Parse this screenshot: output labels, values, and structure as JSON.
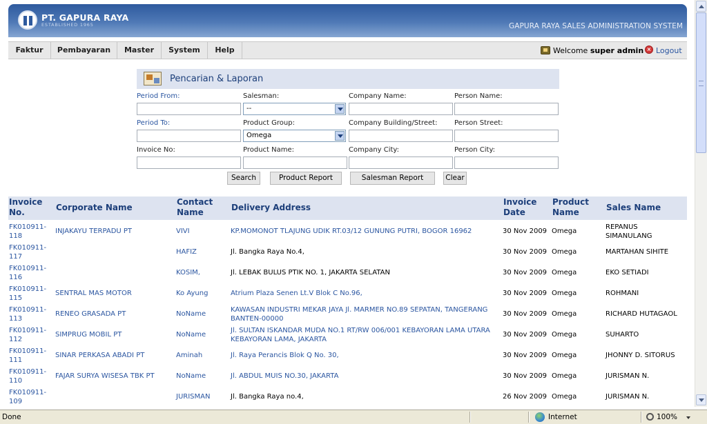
{
  "header": {
    "company_name": "PT. GAPURA RAYA",
    "established": "ESTABLISHED 1965",
    "system_title": "GAPURA RAYA SALES ADMINISTRATION SYSTEM"
  },
  "menu": [
    {
      "label": "Faktur"
    },
    {
      "label": "Pembayaran"
    },
    {
      "label": "Master"
    },
    {
      "label": "System"
    },
    {
      "label": "Help"
    }
  ],
  "user": {
    "welcome": "Welcome",
    "name": "super admin",
    "logout": "Logout"
  },
  "search": {
    "title": "Pencarian & Laporan",
    "period_from_label": "Period From:",
    "salesman_label": "Salesman:",
    "salesman_value": "--",
    "company_name_label": "Company Name:",
    "person_name_label": "Person Name:",
    "period_to_label": "Period To:",
    "product_group_label": "Product Group:",
    "product_group_value": "Omega",
    "company_street_label": "Company Building/Street:",
    "person_street_label": "Person Street:",
    "invoice_no_label": "Invoice No:",
    "product_name_label": "Product Name:",
    "company_city_label": "Company City:",
    "person_city_label": "Person City:",
    "buttons": {
      "search": "Search",
      "product_report": "Product Report",
      "salesman_report": "Salesman Report",
      "clear": "Clear"
    }
  },
  "table": {
    "headers": {
      "invoice": [
        "Invoice",
        "No."
      ],
      "corporate": "Corporate Name",
      "contact": [
        "Contact",
        "Name"
      ],
      "address": "Delivery Address",
      "date": [
        "Invoice",
        "Date"
      ],
      "product": [
        "Product",
        "Name"
      ],
      "sales": "Sales Name"
    },
    "rows": [
      {
        "inv1": "FK010911-",
        "inv2": "118",
        "corp": "INJAKAYU TERPADU PT",
        "contact": "VIVI",
        "addr1": "KP.MOMONOT TLAJUNG UDIK RT.03/12 GUNUNG PUTRI, BOGOR 16962",
        "addr2": "",
        "date": "30 Nov 2009",
        "product": "Omega",
        "sales1": "REPANUS",
        "sales2": "SIMANULANG"
      },
      {
        "inv1": "FK010911-",
        "inv2": "117",
        "corp": "",
        "contact": "HAFIZ",
        "addr1": "Jl. Bangka Raya No.4,",
        "addr2": "",
        "date": "30 Nov 2009",
        "product": "Omega",
        "sales1": "MARTAHAN SIHITE",
        "sales2": ""
      },
      {
        "inv1": "FK010911-",
        "inv2": "116",
        "corp": "",
        "contact": "KOSIM,",
        "addr1": "Jl. LEBAK BULUS PTIK NO. 1, JAKARTA SELATAN",
        "addr2": "",
        "date": "30 Nov 2009",
        "product": "Omega",
        "sales1": "EKO SETIADI",
        "sales2": ""
      },
      {
        "inv1": "FK010911-",
        "inv2": "115",
        "corp": "SENTRAL MAS MOTOR",
        "contact": "Ko Ayung",
        "addr1": "Atrium Plaza Senen Lt.V Blok C No.96,",
        "addr2": "",
        "date": "30 Nov 2009",
        "product": "Omega",
        "sales1": "ROHMANI",
        "sales2": ""
      },
      {
        "inv1": "FK010911-",
        "inv2": "113",
        "corp": "RENEO GRASADA PT",
        "contact": "NoName",
        "addr1": "KAWASAN INDUSTRI MEKAR JAYA Jl. MARMER NO.89 SEPATAN, TANGERANG",
        "addr2": "BANTEN-00000",
        "date": "30 Nov 2009",
        "product": "Omega",
        "sales1": "RICHARD HUTAGAOL",
        "sales2": ""
      },
      {
        "inv1": "FK010911-",
        "inv2": "112",
        "corp": "SIMPRUG MOBIL PT",
        "contact": "NoName",
        "addr1": "Jl. SULTAN ISKANDAR MUDA NO.1 RT/RW 006/001 KEBAYORAN LAMA UTARA",
        "addr2": "KEBAYORAN LAMA, JAKARTA",
        "date": "30 Nov 2009",
        "product": "Omega",
        "sales1": "SUHARTO",
        "sales2": ""
      },
      {
        "inv1": "FK010911-",
        "inv2": "111",
        "corp": "SINAR PERKASA ABADI PT",
        "contact": "Aminah",
        "addr1": "Jl. Raya Perancis Blok Q No. 30,",
        "addr2": "",
        "date": "30 Nov 2009",
        "product": "Omega",
        "sales1": "JHONNY D. SITORUS",
        "sales2": ""
      },
      {
        "inv1": "FK010911-",
        "inv2": "110",
        "corp": "FAJAR SURYA WISESA TBK PT",
        "contact": "NoName",
        "addr1": "Jl. ABDUL MUIS NO.30, JAKARTA",
        "addr2": "",
        "date": "30 Nov 2009",
        "product": "Omega",
        "sales1": "JURISMAN N.",
        "sales2": ""
      },
      {
        "inv1": "FK010911-",
        "inv2": "109",
        "corp": "",
        "contact": "JURISMAN",
        "addr1": "Jl. Bangka Raya no.4,",
        "addr2": "",
        "date": "26 Nov 2009",
        "product": "Omega",
        "sales1": "JURISMAN N.",
        "sales2": ""
      }
    ]
  },
  "statusbar": {
    "status": "Done",
    "zone": "Internet",
    "zoom": "100%"
  }
}
